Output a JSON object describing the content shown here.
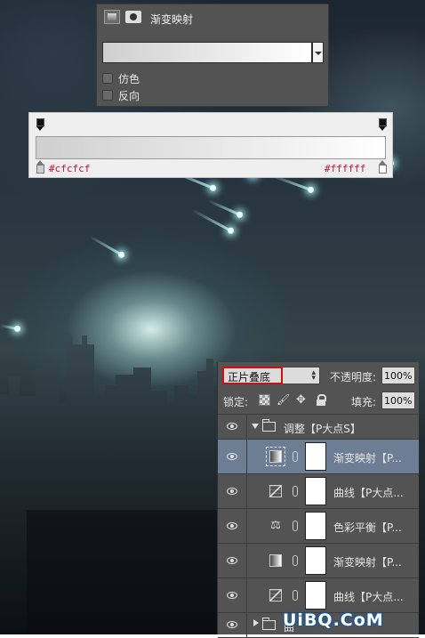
{
  "gradient_map": {
    "icon_adjustment": "gradient-map-adjustment-icon",
    "icon_mask": "layer-mask-icon",
    "title": "渐变映射",
    "gradient_from": "#cfcfcf",
    "gradient_to": "#ffffff",
    "dither_label": "仿色",
    "dither_checked": false,
    "reverse_label": "反向",
    "reverse_checked": false
  },
  "gradient_editor": {
    "left_color": "#cfcfcf",
    "right_color": "#ffffff",
    "left_hex_label": "#cfcfcf",
    "right_hex_label": "#ffffff"
  },
  "layers_panel": {
    "blend_mode": "正片叠底",
    "opacity_label": "不透明度:",
    "opacity_value": "100%",
    "lock_label": "锁定:",
    "fill_label": "填充:",
    "fill_value": "100%",
    "group": {
      "name": "调整【P大点S】",
      "expanded": true
    },
    "layers": [
      {
        "name": "渐变映射【P...",
        "type": "gradient-map",
        "selected": true
      },
      {
        "name": "曲线【P大点...",
        "type": "curves",
        "selected": false
      },
      {
        "name": "色彩平衡【P...",
        "type": "color-balance",
        "selected": false
      },
      {
        "name": "渐变映射【P...",
        "type": "gradient-map",
        "selected": false
      },
      {
        "name": "曲线【P大点...",
        "type": "curves",
        "selected": false
      }
    ],
    "bottom_group": {
      "name": "曲",
      "expanded": false
    }
  },
  "watermark": "UiBQ.CoM"
}
